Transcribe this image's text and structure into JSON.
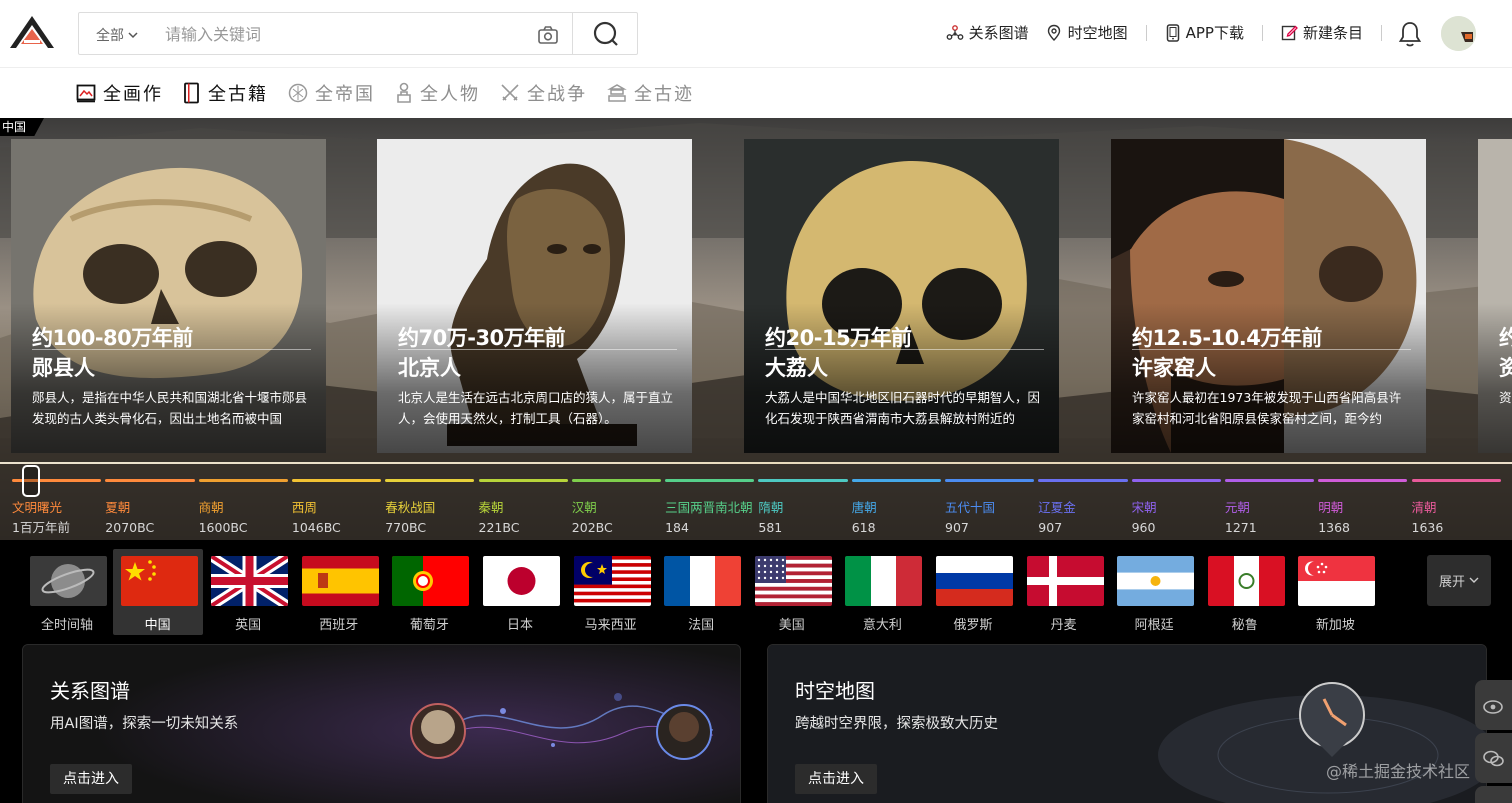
{
  "header": {
    "search_scope": "全部",
    "search_placeholder": "请输入关键词",
    "nav": {
      "graph": "关系图谱",
      "map": "时空地图",
      "app": "APP下载",
      "new_entry": "新建条目"
    }
  },
  "categories": [
    {
      "label": "全画作",
      "active": true
    },
    {
      "label": "全古籍",
      "active": true
    },
    {
      "label": "全帝国",
      "active": false
    },
    {
      "label": "全人物",
      "active": false
    },
    {
      "label": "全战争",
      "active": false
    },
    {
      "label": "全古迹",
      "active": false
    }
  ],
  "hero": {
    "region_tag": "中国",
    "cards": [
      {
        "date": "约100-80万年前",
        "name": "郧县人",
        "desc": "郧县人，是指在中华人民共和国湖北省十堰市郧县发现的古人类头骨化石，因出土地名而被中国"
      },
      {
        "date": "约70万-30万年前",
        "name": "北京人",
        "desc": "北京人是生活在远古北京周口店的猿人，属于直立人，会使用天然火，打制工具（石器）。"
      },
      {
        "date": "约20-15万年前",
        "name": "大荔人",
        "desc": "大荔人是中国华北地区旧石器时代的早期智人，因化石发现于陕西省渭南市大荔县解放村附近的"
      },
      {
        "date": "约12.5-10.4万年前",
        "name": "许家窑人",
        "desc": "许家窑人最初在1973年被发现于山西省阳高县许家窑村和河北省阳原县侯家窑村之间，距今约"
      },
      {
        "date": "约",
        "name": "资",
        "desc": "资"
      }
    ]
  },
  "timeline": [
    {
      "name": "文明曙光",
      "year": "1百万年前",
      "color": "#ff8a3c"
    },
    {
      "name": "夏朝",
      "year": "2070BC",
      "color": "#ff8a3c"
    },
    {
      "name": "商朝",
      "year": "1600BC",
      "color": "#f0a030"
    },
    {
      "name": "西周",
      "year": "1046BC",
      "color": "#f2c233"
    },
    {
      "name": "春秋战国",
      "year": "770BC",
      "color": "#e7d13a"
    },
    {
      "name": "秦朝",
      "year": "221BC",
      "color": "#b7d43a"
    },
    {
      "name": "汉朝",
      "year": "202BC",
      "color": "#7fcf4c"
    },
    {
      "name": "三国两晋南北朝",
      "year": "184",
      "color": "#56cf8a"
    },
    {
      "name": "隋朝",
      "year": "581",
      "color": "#4ec9c2"
    },
    {
      "name": "唐朝",
      "year": "618",
      "color": "#45a8e8"
    },
    {
      "name": "五代十国",
      "year": "907",
      "color": "#4c8cf0"
    },
    {
      "name": "辽夏金",
      "year": "907",
      "color": "#6a70f0"
    },
    {
      "name": "宋朝",
      "year": "960",
      "color": "#8f62ee"
    },
    {
      "name": "元朝",
      "year": "1271",
      "color": "#b05ee8"
    },
    {
      "name": "明朝",
      "year": "1368",
      "color": "#d05cd8"
    },
    {
      "name": "清朝",
      "year": "1636",
      "color": "#e85a9a"
    }
  ],
  "countries": [
    {
      "name": "全时间轴",
      "flag": "globe"
    },
    {
      "name": "中国",
      "flag": "china",
      "selected": true
    },
    {
      "name": "英国",
      "flag": "uk"
    },
    {
      "name": "西班牙",
      "flag": "spain"
    },
    {
      "name": "葡萄牙",
      "flag": "portugal"
    },
    {
      "name": "日本",
      "flag": "japan"
    },
    {
      "name": "马来西亚",
      "flag": "malaysia"
    },
    {
      "name": "法国",
      "flag": "france"
    },
    {
      "name": "美国",
      "flag": "usa"
    },
    {
      "name": "意大利",
      "flag": "italy"
    },
    {
      "name": "俄罗斯",
      "flag": "russia"
    },
    {
      "name": "丹麦",
      "flag": "denmark"
    },
    {
      "name": "阿根廷",
      "flag": "argentina"
    },
    {
      "name": "秘鲁",
      "flag": "peru"
    },
    {
      "name": "新加坡",
      "flag": "singapore"
    }
  ],
  "expand_label": "展开",
  "panels": [
    {
      "title": "关系图谱",
      "subtitle": "用AI图谱，探索一切未知关系",
      "button": "点击进入"
    },
    {
      "title": "时空地图",
      "subtitle": "跨越时空界限，探索极致大历史",
      "button": "点击进入"
    }
  ],
  "watermark": "@稀土掘金技术社区"
}
